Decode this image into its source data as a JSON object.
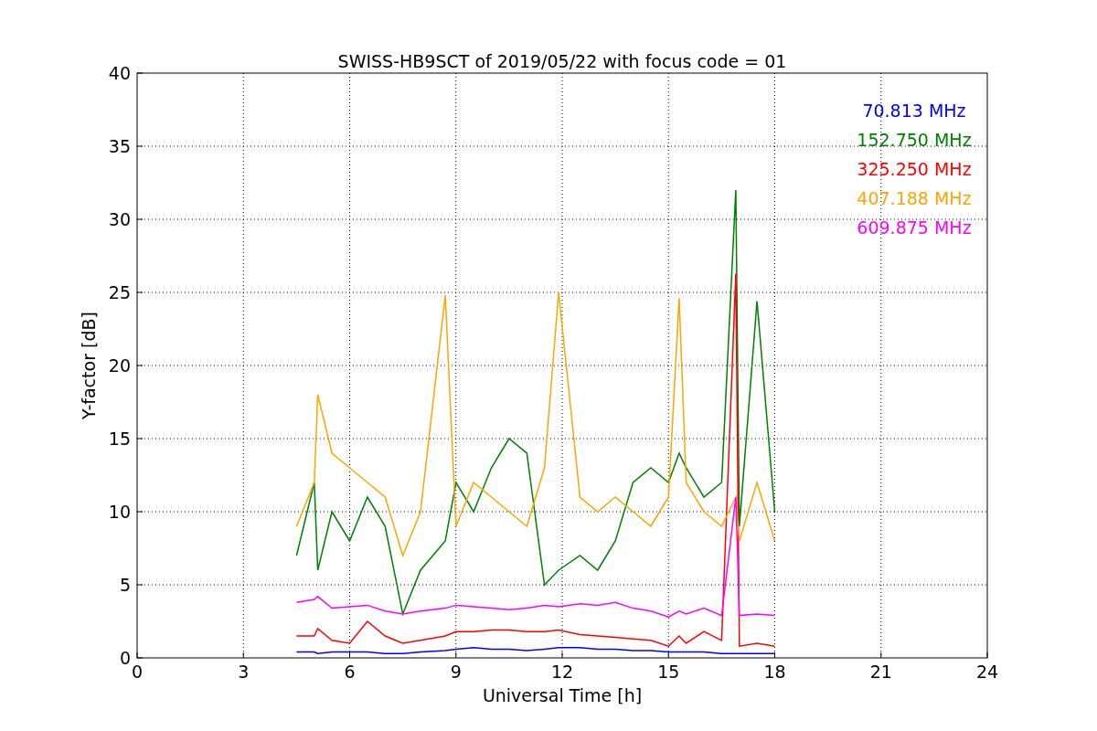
{
  "chart_data": {
    "type": "line",
    "title": "SWISS-HB9SCT of 2019/05/22 with focus code = 01",
    "xlabel": "Universal Time [h]",
    "ylabel": "Y-factor [dB]",
    "x": [
      4.5,
      5,
      5.1,
      5.5,
      6,
      6.5,
      7,
      7.5,
      8,
      8.7,
      9,
      9.5,
      10,
      10.5,
      11,
      11.5,
      11.9,
      12.5,
      13,
      13.5,
      14,
      14.5,
      15,
      15.3,
      15.5,
      16,
      16.5,
      16.9,
      17,
      17.5,
      18
    ],
    "series": [
      {
        "name": "70.813 MHz",
        "color": "#0000ff",
        "values": [
          0.4,
          0.4,
          0.3,
          0.4,
          0.4,
          0.4,
          0.3,
          0.3,
          0.4,
          0.5,
          0.6,
          0.7,
          0.6,
          0.6,
          0.5,
          0.6,
          0.7,
          0.7,
          0.6,
          0.6,
          0.5,
          0.5,
          0.4,
          0.4,
          0.4,
          0.4,
          0.3,
          0.3,
          0.3,
          0.3,
          0.3
        ]
      },
      {
        "name": "152.750 MHz",
        "color": "#008000",
        "values": [
          7,
          12,
          6,
          10,
          8,
          11,
          9,
          3,
          6,
          8,
          12,
          10,
          13,
          15,
          14,
          5,
          6,
          7,
          6,
          8,
          12,
          13,
          12,
          14,
          13,
          11,
          12,
          32,
          9,
          24.4,
          10
        ]
      },
      {
        "name": "325.250 MHz",
        "color": "#ff0000",
        "values": [
          1.5,
          1.5,
          2,
          1.2,
          1.0,
          2.5,
          1.5,
          1.0,
          1.2,
          1.5,
          1.8,
          1.8,
          1.9,
          1.9,
          1.8,
          1.8,
          1.9,
          1.6,
          1.5,
          1.4,
          1.3,
          1.2,
          0.8,
          1.5,
          1.0,
          1.8,
          1.2,
          26.3,
          0.8,
          1.0,
          0.8
        ]
      },
      {
        "name": "407.188 MHz",
        "color": "#ffa500",
        "values": [
          9,
          12,
          18,
          14,
          13,
          12,
          11,
          7,
          10,
          24.8,
          9,
          12,
          11,
          10,
          9,
          13,
          25,
          11,
          10,
          11,
          10,
          9,
          11,
          24.6,
          12,
          10,
          9,
          11,
          8,
          12,
          8
        ]
      },
      {
        "name": "609.875 MHz",
        "color": "#ff00ff",
        "values": [
          3.8,
          4.0,
          4.2,
          3.4,
          3.5,
          3.6,
          3.2,
          3.0,
          3.2,
          3.4,
          3.6,
          3.5,
          3.4,
          3.3,
          3.4,
          3.6,
          3.5,
          3.7,
          3.6,
          3.8,
          3.4,
          3.2,
          2.8,
          3.2,
          3.0,
          3.4,
          2.9,
          11,
          2.9,
          3.0,
          2.9
        ]
      }
    ],
    "xlim": [
      0,
      24
    ],
    "ylim": [
      0,
      40
    ],
    "xticks": [
      0,
      3,
      6,
      9,
      12,
      15,
      18,
      21,
      24
    ],
    "yticks": [
      0,
      5,
      10,
      15,
      20,
      25,
      30,
      35,
      40
    ],
    "grid": true
  }
}
